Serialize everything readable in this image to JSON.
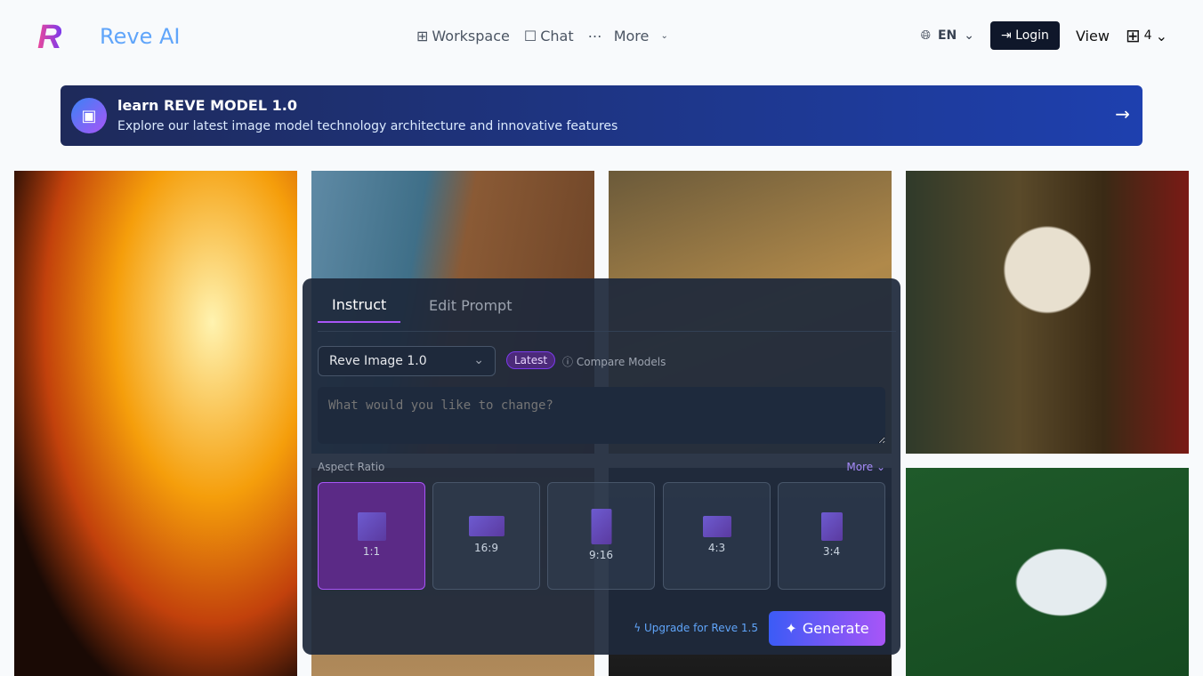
{
  "header": {
    "brand": "Reve AI",
    "nav": [
      {
        "icon": "grid-icon",
        "label": "Workspace"
      },
      {
        "icon": "chat-icon",
        "label": "Chat"
      },
      {
        "icon": "dots-icon",
        "label": "More"
      }
    ],
    "language": "EN",
    "login": "Login",
    "view": "View",
    "columns": "4"
  },
  "banner": {
    "title": "learn REVE MODEL 1.0",
    "subtitle": "Explore our latest image model technology architecture and innovative features"
  },
  "panel": {
    "tabs": [
      "Instruct",
      "Edit Prompt"
    ],
    "active_tab": "Instruct",
    "model": "Reve Image 1.0",
    "badge": "Latest",
    "compare": "Compare Models",
    "placeholder": "What would you like to change?",
    "aspect_label": "Aspect Ratio",
    "more": "More",
    "ratios": [
      "1:1",
      "16:9",
      "9:16",
      "4:3",
      "3:4"
    ],
    "selected_ratio": "1:1",
    "upgrade": "Upgrade for Reve 1.5",
    "generate": "Generate"
  }
}
